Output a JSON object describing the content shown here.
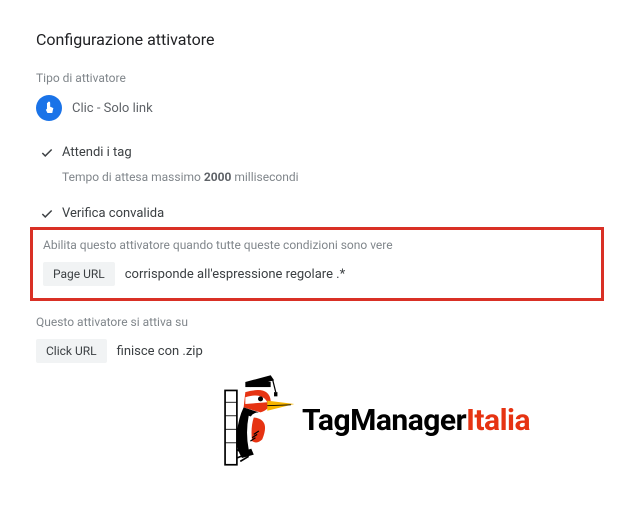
{
  "header": {
    "title": "Configurazione attivatore"
  },
  "triggerType": {
    "label": "Tipo di attivatore",
    "value": "Clic - Solo link"
  },
  "wait": {
    "checkbox_label": "Attendi i tag",
    "text_prefix": "Tempo di attesa massimo ",
    "text_value": "2000",
    "text_suffix": " millisecondi"
  },
  "validation": {
    "checkbox_label": "Verifica convalida"
  },
  "enableConditions": {
    "label": "Abilita questo attivatore quando tutte queste condizioni sono vere",
    "variable": "Page URL",
    "operator_value": "corrisponde all'espressione regolare .*"
  },
  "firesOn": {
    "label": "Questo attivatore si attiva su",
    "variable": "Click URL",
    "operator_value": "finisce con .zip"
  },
  "logo": {
    "text1": "TagManager",
    "text2": "Italia"
  }
}
